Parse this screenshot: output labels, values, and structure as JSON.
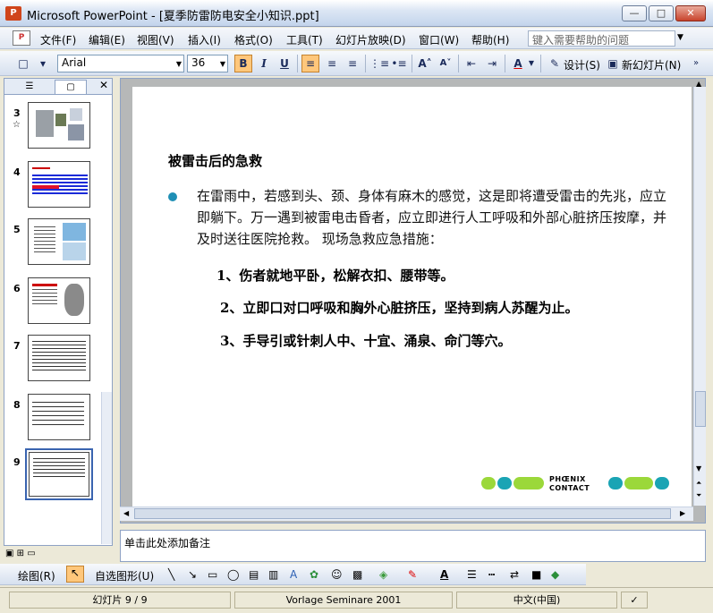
{
  "window": {
    "title": "Microsoft PowerPoint - [夏季防雷防电安全小知识.ppt]",
    "app_icon": "P",
    "minimize_label": "—",
    "restore_label": "□",
    "close_label": "✕"
  },
  "menubar": {
    "items": [
      "文件(F)",
      "编辑(E)",
      "视图(V)",
      "插入(I)",
      "格式(O)",
      "工具(T)",
      "幻灯片放映(D)",
      "窗口(W)",
      "帮助(H)"
    ],
    "help_placeholder": "键入需要帮助的问题"
  },
  "toolbar": {
    "font": "Arial",
    "size": "36",
    "bold": "B",
    "italic": "I",
    "underline": "U",
    "design_label": "设计(S)",
    "new_slide_label": "新幻灯片(N)"
  },
  "outline": {
    "thumbnails": [
      {
        "num": "3",
        "marker": "☆"
      },
      {
        "num": "4"
      },
      {
        "num": "5"
      },
      {
        "num": "6"
      },
      {
        "num": "7"
      },
      {
        "num": "8"
      },
      {
        "num": "9"
      }
    ]
  },
  "slide": {
    "title": "被雷击后的急救",
    "body": "在雷雨中，若感到头、颈、身体有麻木的感觉，这是即将遭受雷击的先兆，应立即躺下。万一遇到被雷电击昏者，应立即进行人工呼吸和外部心脏挤压按摩，并及时送往医院抢救。 现场急救应急措施：",
    "steps": [
      "1、伤者就地平卧，松解衣扣、腰带等。",
      "2、立即口对口呼吸和胸外心脏挤压，坚持到病人苏醒为止。",
      "3、手导引或针刺人中、十宜、涌泉、命门等穴。"
    ],
    "logo_text_1": "PHŒNIX",
    "logo_text_2": "CONTACT",
    "colors": {
      "green": "#9bd83a",
      "teal": "#1aa4b4",
      "bullet": "#1f8fb5"
    }
  },
  "notes": {
    "placeholder": "单击此处添加备注"
  },
  "drawbar": {
    "draw_label": "绘图(R)",
    "autoshape_label": "自选图形(U)"
  },
  "status": {
    "slide_info": "幻灯片 9 / 9",
    "template": "Vorlage Seminare 2001",
    "language": "中文(中国)"
  }
}
